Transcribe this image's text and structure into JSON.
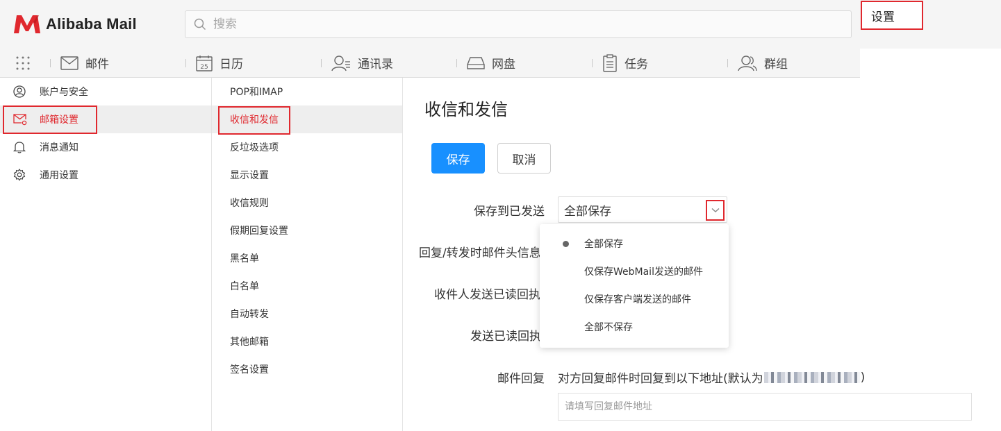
{
  "app": {
    "logo_text": "Alibaba Mail",
    "brand_color": "#e0282e",
    "accent_color": "#1890ff"
  },
  "search": {
    "placeholder": "搜索"
  },
  "nav": {
    "items": [
      {
        "label": "邮件",
        "icon": "mail-icon"
      },
      {
        "label": "日历",
        "icon": "calendar-icon",
        "badge": "25"
      },
      {
        "label": "通讯录",
        "icon": "contacts-icon"
      },
      {
        "label": "网盘",
        "icon": "drive-icon"
      },
      {
        "label": "任务",
        "icon": "task-icon"
      },
      {
        "label": "群组",
        "icon": "group-icon"
      }
    ],
    "settings_label": "设置"
  },
  "sidebar": {
    "items": [
      {
        "label": "账户与安全",
        "icon": "user-icon"
      },
      {
        "label": "邮箱设置",
        "icon": "mailbox-settings-icon",
        "active": true
      },
      {
        "label": "消息通知",
        "icon": "bell-icon"
      },
      {
        "label": "通用设置",
        "icon": "gear-icon"
      }
    ]
  },
  "submenu": {
    "items": [
      {
        "label": "POP和IMAP"
      },
      {
        "label": "收信和发信",
        "active": true
      },
      {
        "label": "反垃圾选项"
      },
      {
        "label": "显示设置"
      },
      {
        "label": "收信规则"
      },
      {
        "label": "假期回复设置"
      },
      {
        "label": "黑名单"
      },
      {
        "label": "白名单"
      },
      {
        "label": "自动转发"
      },
      {
        "label": "其他邮箱"
      },
      {
        "label": "签名设置"
      }
    ]
  },
  "content": {
    "title": "收信和发信",
    "save_label": "保存",
    "cancel_label": "取消",
    "fields": {
      "save_to_sent_label": "保存到已发送",
      "save_to_sent_value": "全部保存",
      "reply_header_label": "回复/转发时邮件头信息",
      "read_receipt_label": "收件人发送已读回执",
      "send_receipt_label": "发送已读回执",
      "reply_label": "邮件回复",
      "reply_desc_prefix": "对方回复邮件时回复到以下地址(默认为",
      "reply_desc_suffix": ")",
      "reply_placeholder": "请填写回复邮件地址"
    }
  },
  "dropdown": {
    "options": [
      {
        "label": "全部保存",
        "selected": true
      },
      {
        "label": "仅保存WebMail发送的邮件"
      },
      {
        "label": "仅保存客户端发送的邮件"
      },
      {
        "label": "全部不保存"
      }
    ]
  }
}
